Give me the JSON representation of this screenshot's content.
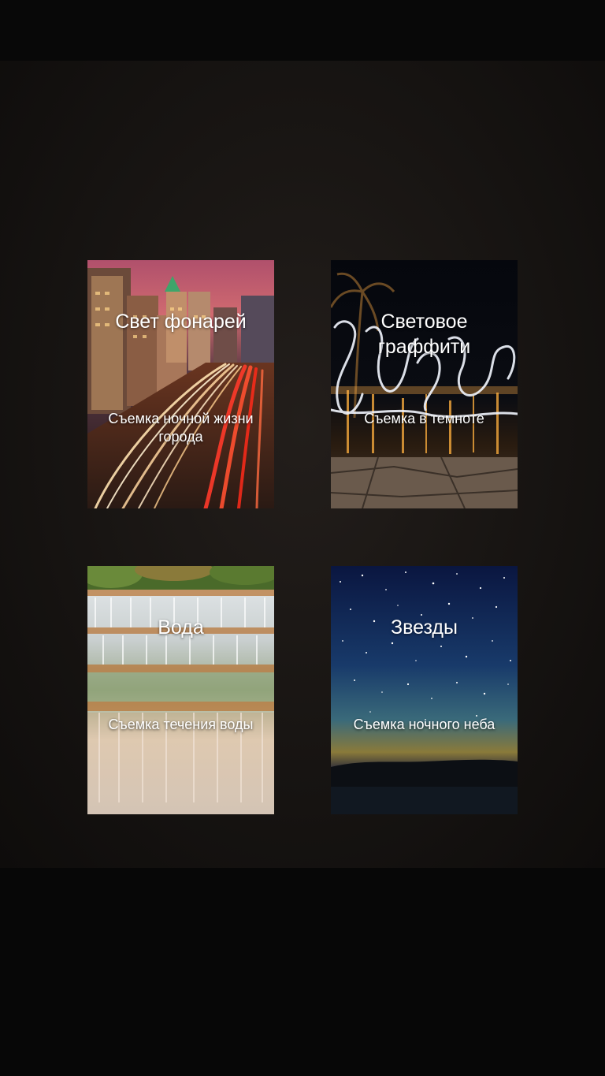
{
  "cards": [
    {
      "title": "Свет фонарей",
      "subtitle": "Съемка ночной жизни города",
      "image": "city-night-traffic-photo",
      "selected": true
    },
    {
      "title": "Световое граффити",
      "subtitle": "Съемка в темноте",
      "image": "light-graffiti-photo",
      "selected": false
    },
    {
      "title": "Вода",
      "subtitle": "Съемка течения воды",
      "image": "waterfall-photo",
      "selected": false
    },
    {
      "title": "Звезды",
      "subtitle": "Съемка ночного неба",
      "image": "starry-sky-photo",
      "selected": false
    }
  ],
  "colors": {
    "selection_outline": "#2d8fe6",
    "background": "#171412"
  }
}
